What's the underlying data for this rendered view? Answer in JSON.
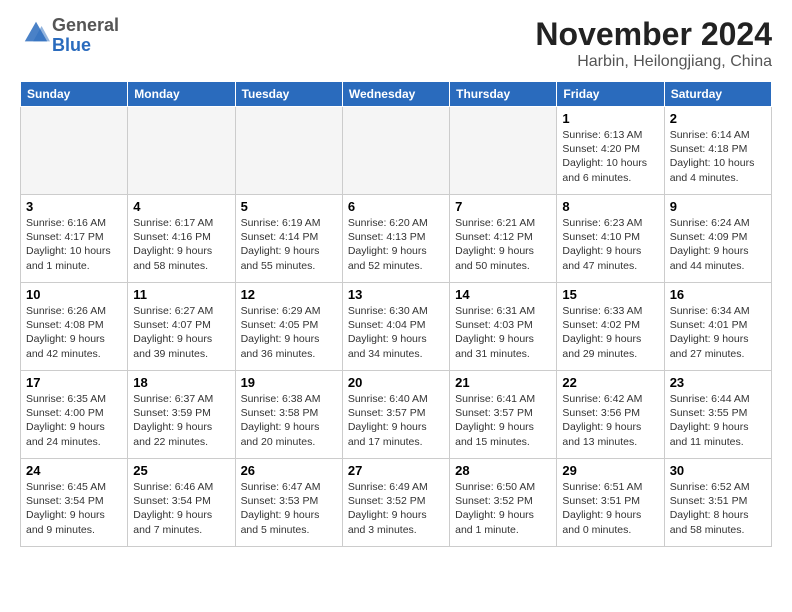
{
  "header": {
    "logo_general": "General",
    "logo_blue": "Blue",
    "month_title": "November 2024",
    "location": "Harbin, Heilongjiang, China"
  },
  "days_of_week": [
    "Sunday",
    "Monday",
    "Tuesday",
    "Wednesday",
    "Thursday",
    "Friday",
    "Saturday"
  ],
  "weeks": [
    [
      {
        "day": "",
        "info": ""
      },
      {
        "day": "",
        "info": ""
      },
      {
        "day": "",
        "info": ""
      },
      {
        "day": "",
        "info": ""
      },
      {
        "day": "",
        "info": ""
      },
      {
        "day": "1",
        "info": "Sunrise: 6:13 AM\nSunset: 4:20 PM\nDaylight: 10 hours and 6 minutes."
      },
      {
        "day": "2",
        "info": "Sunrise: 6:14 AM\nSunset: 4:18 PM\nDaylight: 10 hours and 4 minutes."
      }
    ],
    [
      {
        "day": "3",
        "info": "Sunrise: 6:16 AM\nSunset: 4:17 PM\nDaylight: 10 hours and 1 minute."
      },
      {
        "day": "4",
        "info": "Sunrise: 6:17 AM\nSunset: 4:16 PM\nDaylight: 9 hours and 58 minutes."
      },
      {
        "day": "5",
        "info": "Sunrise: 6:19 AM\nSunset: 4:14 PM\nDaylight: 9 hours and 55 minutes."
      },
      {
        "day": "6",
        "info": "Sunrise: 6:20 AM\nSunset: 4:13 PM\nDaylight: 9 hours and 52 minutes."
      },
      {
        "day": "7",
        "info": "Sunrise: 6:21 AM\nSunset: 4:12 PM\nDaylight: 9 hours and 50 minutes."
      },
      {
        "day": "8",
        "info": "Sunrise: 6:23 AM\nSunset: 4:10 PM\nDaylight: 9 hours and 47 minutes."
      },
      {
        "day": "9",
        "info": "Sunrise: 6:24 AM\nSunset: 4:09 PM\nDaylight: 9 hours and 44 minutes."
      }
    ],
    [
      {
        "day": "10",
        "info": "Sunrise: 6:26 AM\nSunset: 4:08 PM\nDaylight: 9 hours and 42 minutes."
      },
      {
        "day": "11",
        "info": "Sunrise: 6:27 AM\nSunset: 4:07 PM\nDaylight: 9 hours and 39 minutes."
      },
      {
        "day": "12",
        "info": "Sunrise: 6:29 AM\nSunset: 4:05 PM\nDaylight: 9 hours and 36 minutes."
      },
      {
        "day": "13",
        "info": "Sunrise: 6:30 AM\nSunset: 4:04 PM\nDaylight: 9 hours and 34 minutes."
      },
      {
        "day": "14",
        "info": "Sunrise: 6:31 AM\nSunset: 4:03 PM\nDaylight: 9 hours and 31 minutes."
      },
      {
        "day": "15",
        "info": "Sunrise: 6:33 AM\nSunset: 4:02 PM\nDaylight: 9 hours and 29 minutes."
      },
      {
        "day": "16",
        "info": "Sunrise: 6:34 AM\nSunset: 4:01 PM\nDaylight: 9 hours and 27 minutes."
      }
    ],
    [
      {
        "day": "17",
        "info": "Sunrise: 6:35 AM\nSunset: 4:00 PM\nDaylight: 9 hours and 24 minutes."
      },
      {
        "day": "18",
        "info": "Sunrise: 6:37 AM\nSunset: 3:59 PM\nDaylight: 9 hours and 22 minutes."
      },
      {
        "day": "19",
        "info": "Sunrise: 6:38 AM\nSunset: 3:58 PM\nDaylight: 9 hours and 20 minutes."
      },
      {
        "day": "20",
        "info": "Sunrise: 6:40 AM\nSunset: 3:57 PM\nDaylight: 9 hours and 17 minutes."
      },
      {
        "day": "21",
        "info": "Sunrise: 6:41 AM\nSunset: 3:57 PM\nDaylight: 9 hours and 15 minutes."
      },
      {
        "day": "22",
        "info": "Sunrise: 6:42 AM\nSunset: 3:56 PM\nDaylight: 9 hours and 13 minutes."
      },
      {
        "day": "23",
        "info": "Sunrise: 6:44 AM\nSunset: 3:55 PM\nDaylight: 9 hours and 11 minutes."
      }
    ],
    [
      {
        "day": "24",
        "info": "Sunrise: 6:45 AM\nSunset: 3:54 PM\nDaylight: 9 hours and 9 minutes."
      },
      {
        "day": "25",
        "info": "Sunrise: 6:46 AM\nSunset: 3:54 PM\nDaylight: 9 hours and 7 minutes."
      },
      {
        "day": "26",
        "info": "Sunrise: 6:47 AM\nSunset: 3:53 PM\nDaylight: 9 hours and 5 minutes."
      },
      {
        "day": "27",
        "info": "Sunrise: 6:49 AM\nSunset: 3:52 PM\nDaylight: 9 hours and 3 minutes."
      },
      {
        "day": "28",
        "info": "Sunrise: 6:50 AM\nSunset: 3:52 PM\nDaylight: 9 hours and 1 minute."
      },
      {
        "day": "29",
        "info": "Sunrise: 6:51 AM\nSunset: 3:51 PM\nDaylight: 9 hours and 0 minutes."
      },
      {
        "day": "30",
        "info": "Sunrise: 6:52 AM\nSunset: 3:51 PM\nDaylight: 8 hours and 58 minutes."
      }
    ]
  ]
}
